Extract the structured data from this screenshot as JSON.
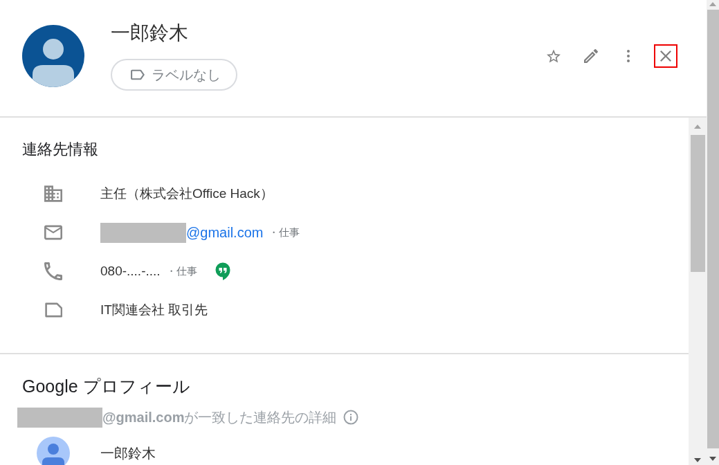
{
  "contact": {
    "name": "一郎鈴木",
    "label_chip": "ラベルなし"
  },
  "actions": [
    {
      "kind": "star",
      "highlighted": false
    },
    {
      "kind": "edit",
      "highlighted": false
    },
    {
      "kind": "more",
      "highlighted": false
    },
    {
      "kind": "close",
      "highlighted": true
    }
  ],
  "contact_info": {
    "title": "連絡先情報",
    "rows": [
      {
        "kind": "company",
        "value": "主任（株式会社Office Hack）"
      },
      {
        "kind": "email",
        "redacted": true,
        "value": "@gmail.com",
        "type": "・仕事"
      },
      {
        "kind": "phone",
        "value": "080-....-....",
        "type": "・仕事"
      },
      {
        "kind": "labels",
        "value": "IT関連会社 取引先"
      }
    ]
  },
  "google_profile": {
    "title": "Google プロフィール",
    "redacted": true,
    "match_note": "**@gmail.com**が一致した連絡先の詳細",
    "name": "一郎鈴木"
  }
}
